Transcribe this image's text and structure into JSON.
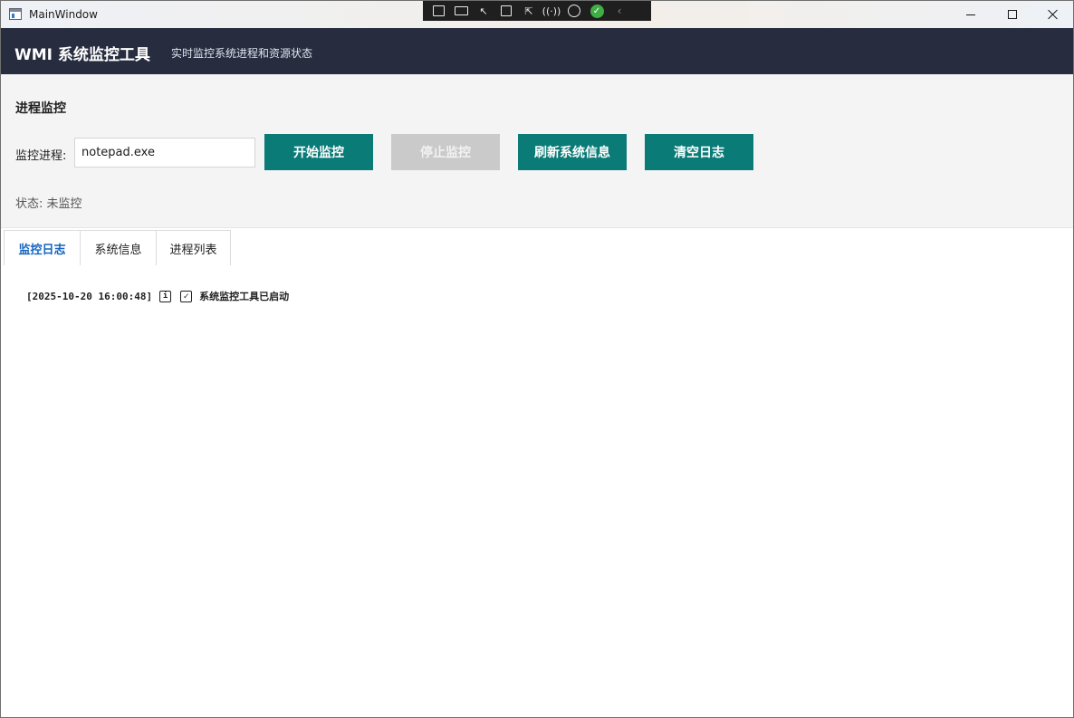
{
  "window": {
    "title": "MainWindow"
  },
  "header": {
    "title": "WMI 系统监控工具",
    "subtitle": "实时监控系统进程和资源状态"
  },
  "panel": {
    "section_title": "进程监控",
    "field_label": "监控进程:",
    "process_value": "notepad.exe",
    "buttons": {
      "start": "开始监控",
      "stop": "停止监控",
      "refresh": "刷新系统信息",
      "clear": "清空日志"
    },
    "status": "状态: 未监控"
  },
  "tabs": [
    {
      "label": "监控日志",
      "active": true
    },
    {
      "label": "系统信息",
      "active": false
    },
    {
      "label": "进程列表",
      "active": false
    }
  ],
  "log": {
    "entries": [
      {
        "timestamp": "[2025-10-20 16:00:48]",
        "message": "系统监控工具已启动"
      }
    ]
  },
  "colors": {
    "header_bg": "#272c3f",
    "accent_button": "#0a7b76",
    "disabled_button": "#cacaca",
    "active_tab": "#1565c0"
  }
}
